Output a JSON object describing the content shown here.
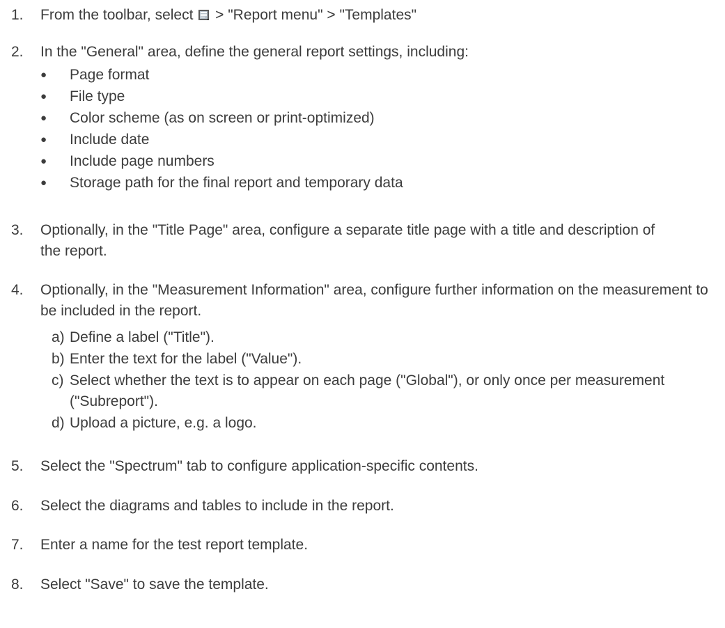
{
  "steps": [
    {
      "num": "1.",
      "before": "From the toolbar, select",
      "icon": "report-menu-icon",
      "after": "> \"Report menu\" > \"Templates\""
    },
    {
      "num": "2.",
      "text": "In the \"General\" area, define the general report settings, including:",
      "bullets": [
        "Page format",
        "File type",
        "Color scheme (as on screen or print-optimized)",
        "Include date",
        "Include page numbers",
        "Storage path for the final report and temporary data"
      ]
    },
    {
      "num": "3.",
      "text": "Optionally, in the \"Title Page\" area, configure a separate title page with a title and description of the report."
    },
    {
      "num": "4.",
      "text": "Optionally, in the \"Measurement Information\" area, configure further information on the measurement to be included in the report.",
      "substeps": [
        {
          "label": "a)",
          "text": "Define a label (\"Title\")."
        },
        {
          "label": "b)",
          "text": "Enter the text for the label (\"Value\")."
        },
        {
          "label": "c)",
          "text": "Select whether the text is to appear on each page (\"Global\"), or only once per measurement (\"Subreport\")."
        },
        {
          "label": "d)",
          "text": "Upload a picture, e.g. a logo."
        }
      ]
    },
    {
      "num": "5.",
      "text": "Select the \"Spectrum\" tab to configure application-specific contents."
    },
    {
      "num": "6.",
      "text": "Select the diagrams and tables to include in the report."
    },
    {
      "num": "7.",
      "text": "Enter a name for the test report template."
    },
    {
      "num": "8.",
      "text": "Select \"Save\" to save the template."
    }
  ],
  "bullet_glyph": "●"
}
